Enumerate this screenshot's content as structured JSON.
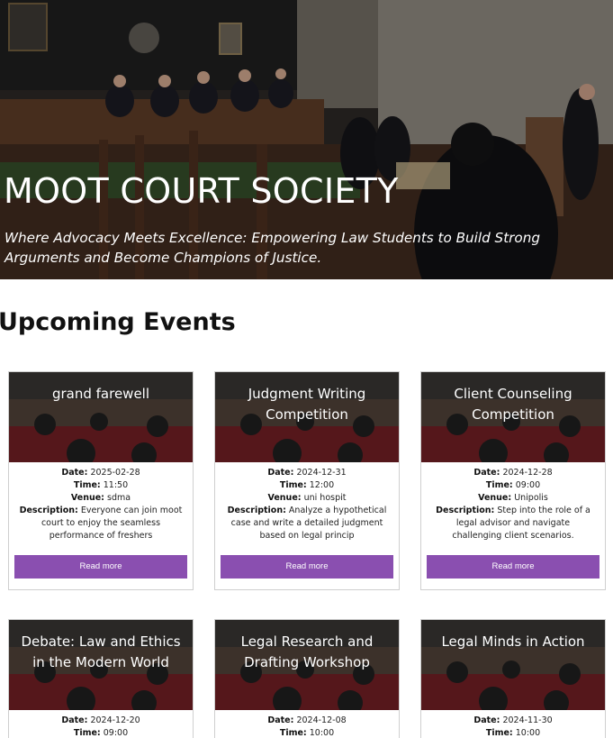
{
  "hero": {
    "title": "MOOT COURT SOCIETY",
    "subtitle": "Where Advocacy Meets Excellence: Empowering Law Students to Build Strong Arguments and Become Champions of Justice."
  },
  "events_section": {
    "title": "Upcoming Events",
    "labels": {
      "date": "Date:",
      "time": "Time:",
      "venue": "Venue:",
      "description": "Description:"
    },
    "read_more_label": "Read more",
    "events": [
      {
        "title": "grand farewell",
        "date": "2025-02-28",
        "time": "11:50",
        "venue": "sdma",
        "description": "Everyone can join moot court to enjoy the seamless performance of freshers"
      },
      {
        "title": "Judgment Writing Competition",
        "date": "2024-12-31",
        "time": "12:00",
        "venue": "uni hospit",
        "description": "Analyze a hypothetical case and write a detailed judgment based on legal princip"
      },
      {
        "title": "Client Counseling Competition",
        "date": "2024-12-28",
        "time": "09:00",
        "venue": "Unipolis",
        "description": "Step into the role of a legal advisor and navigate challenging client scenarios."
      },
      {
        "title": "Debate: Law and Ethics in the Modern World",
        "date": "2024-12-20",
        "time": "09:00"
      },
      {
        "title": "Legal Research and Drafting Workshop",
        "date": "2024-12-08",
        "time": "10:00"
      },
      {
        "title": "Legal Minds in Action",
        "date": "2024-11-30",
        "time": "10:00"
      }
    ]
  },
  "colors": {
    "button": "#8a4fb0",
    "hero_text": "#ffffff"
  }
}
